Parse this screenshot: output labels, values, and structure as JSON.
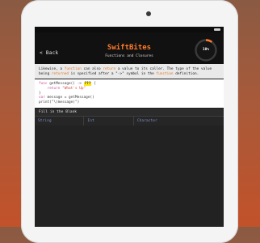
{
  "header": {
    "back_label": "< Back",
    "title": "SwiftBites",
    "subtitle": "Functions and Closures",
    "progress_label": "10%",
    "progress_fraction": 0.1
  },
  "lesson": {
    "desc_parts": [
      {
        "t": "Likewise, a ",
        "k": false
      },
      {
        "t": "function",
        "k": true
      },
      {
        "t": " can also ",
        "k": false
      },
      {
        "t": "return",
        "k": true
      },
      {
        "t": " a value to its caller. The type of the value being ",
        "k": false
      },
      {
        "t": "returned",
        "k": true
      },
      {
        "t": " is specified after a \"->\" symbol in the ",
        "k": false
      },
      {
        "t": "function",
        "k": true
      },
      {
        "t": " definition.",
        "k": false
      }
    ],
    "code": {
      "line1_kw": "func",
      "line1_rest": " getMessage() -> ",
      "line1_blank": "???",
      "line1_end": " {",
      "line2_kw": "    return",
      "line2_str": " \"What's Up\"",
      "line3": "}",
      "line4_kw": "var",
      "line4_rest": " message = getMessage()",
      "line5_rest": "print(\"\\(message)\")"
    }
  },
  "quiz": {
    "prompt": "Fill in the Blank",
    "options": [
      "String",
      "Int",
      "Character"
    ]
  },
  "colors": {
    "accent": "#ff7a2a",
    "option_text": "#7f8ec7",
    "blank_highlight": "#ffe81a"
  }
}
